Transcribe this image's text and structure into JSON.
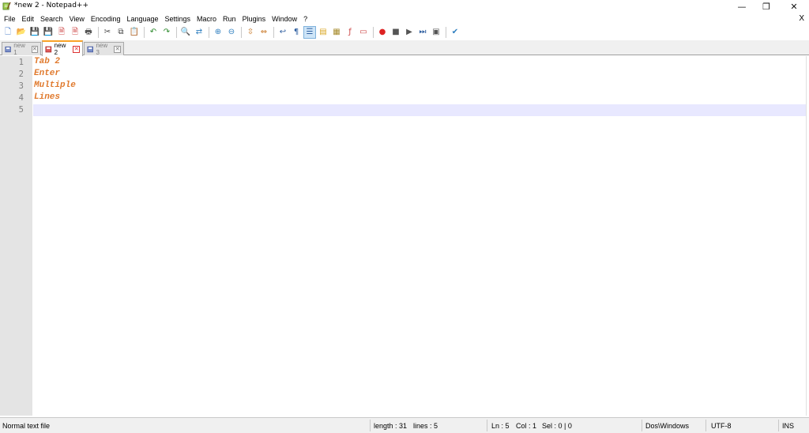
{
  "window": {
    "title": "*new 2 - Notepad++",
    "minimize_glyph": "—",
    "maximize_glyph": "❐",
    "close_glyph": "✕"
  },
  "menu": {
    "items": [
      "File",
      "Edit",
      "Search",
      "View",
      "Encoding",
      "Language",
      "Settings",
      "Macro",
      "Run",
      "Plugins",
      "Window",
      "?"
    ],
    "close_doc": "X"
  },
  "toolbar": {
    "buttons": [
      {
        "name": "new-file-icon",
        "glyph": "🗋",
        "color": "#4a7cc9"
      },
      {
        "name": "open-file-icon",
        "glyph": "📂",
        "color": "#d9a520"
      },
      {
        "name": "save-icon",
        "glyph": "💾",
        "color": "#3b6fc1"
      },
      {
        "name": "save-all-icon",
        "glyph": "💾",
        "color": "#3b6fc1"
      },
      {
        "name": "close-icon",
        "glyph": "🗎",
        "color": "#c44"
      },
      {
        "name": "close-all-icon",
        "glyph": "🗎",
        "color": "#c44"
      },
      {
        "name": "print-icon",
        "glyph": "🖶",
        "color": "#555"
      },
      {
        "sep": true
      },
      {
        "name": "cut-icon",
        "glyph": "✂",
        "color": "#444"
      },
      {
        "name": "copy-icon",
        "glyph": "⧉",
        "color": "#444"
      },
      {
        "name": "paste-icon",
        "glyph": "📋",
        "color": "#a57a2a"
      },
      {
        "sep": true
      },
      {
        "name": "undo-icon",
        "glyph": "↶",
        "color": "#2d8a2d"
      },
      {
        "name": "redo-icon",
        "glyph": "↷",
        "color": "#2d8a2d"
      },
      {
        "sep": true
      },
      {
        "name": "find-icon",
        "glyph": "🔍",
        "color": "#333"
      },
      {
        "name": "replace-icon",
        "glyph": "⇄",
        "color": "#2f7fc0"
      },
      {
        "sep": true
      },
      {
        "name": "zoom-in-icon",
        "glyph": "⊕",
        "color": "#2f7fc0"
      },
      {
        "name": "zoom-out-icon",
        "glyph": "⊖",
        "color": "#2f7fc0"
      },
      {
        "sep": true
      },
      {
        "name": "sync-vertical-icon",
        "glyph": "⇳",
        "color": "#c97a2a"
      },
      {
        "name": "sync-horizontal-icon",
        "glyph": "⇔",
        "color": "#c97a2a"
      },
      {
        "sep": true
      },
      {
        "name": "word-wrap-icon",
        "glyph": "↩",
        "color": "#2f5fa0"
      },
      {
        "name": "show-all-chars-icon",
        "glyph": "¶",
        "color": "#2f5fa0"
      },
      {
        "name": "indent-guide-icon",
        "glyph": "☰",
        "color": "#2f5fa0",
        "active": true
      },
      {
        "name": "user-language-icon",
        "glyph": "▤",
        "color": "#d9a520"
      },
      {
        "name": "document-map-icon",
        "glyph": "▦",
        "color": "#a58a2a"
      },
      {
        "name": "function-list-icon",
        "glyph": "ƒ",
        "color": "#c44"
      },
      {
        "name": "folder-as-workspace-icon",
        "glyph": "▭",
        "color": "#c44"
      },
      {
        "sep": true
      },
      {
        "name": "record-macro-icon",
        "glyph": "●",
        "color": "#d22"
      },
      {
        "name": "stop-record-icon",
        "glyph": "■",
        "color": "#555"
      },
      {
        "name": "play-macro-icon",
        "glyph": "▶",
        "color": "#555"
      },
      {
        "name": "play-macro-multiple-icon",
        "glyph": "⏭",
        "color": "#2f5fa0"
      },
      {
        "name": "save-macro-icon",
        "glyph": "▣",
        "color": "#555"
      },
      {
        "sep": true
      },
      {
        "name": "spell-check-icon",
        "glyph": "✔",
        "color": "#2f7fc0"
      }
    ]
  },
  "tabs": [
    {
      "label": "new 1",
      "active": false
    },
    {
      "label": "new 2",
      "active": true
    },
    {
      "label": "new 3",
      "active": false
    }
  ],
  "editor": {
    "lines": [
      "Tab 2",
      "Enter",
      "Multiple",
      "Lines",
      ""
    ],
    "line_numbers": [
      "1",
      "2",
      "3",
      "4",
      "5"
    ],
    "current_line": 5,
    "text_color": "#e07a2e"
  },
  "status": {
    "file_type": "Normal text file",
    "length": "length : 31",
    "lines": "lines : 5",
    "ln": "Ln : 5",
    "col": "Col : 1",
    "sel": "Sel : 0 | 0",
    "eol": "Dos\\Windows",
    "encoding": "UTF-8",
    "mode": "INS"
  }
}
